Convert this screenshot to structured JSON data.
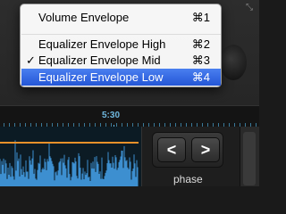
{
  "timeline": {
    "time_label": "5:30"
  },
  "panel": {
    "prev_symbol": "<",
    "next_symbol": ">",
    "phase_label": "phase"
  },
  "menu": {
    "items": [
      {
        "label": "Volume Envelope",
        "shortcut": "⌘1",
        "checked": false,
        "highlighted": false
      },
      {
        "label": "Equalizer Envelope High",
        "shortcut": "⌘2",
        "checked": false,
        "highlighted": false
      },
      {
        "label": "Equalizer Envelope Mid",
        "shortcut": "⌘3",
        "checked": true,
        "highlighted": false
      },
      {
        "label": "Equalizer Envelope Low",
        "shortcut": "⌘4",
        "checked": false,
        "highlighted": true
      }
    ],
    "check_mark": "✓"
  },
  "colors": {
    "highlight": "#2f64e0",
    "envelope": "#e8902a",
    "waveform": "#3d8fd0",
    "time_label": "#6fb7dd"
  },
  "icons": {
    "corner": "resize-icon"
  }
}
